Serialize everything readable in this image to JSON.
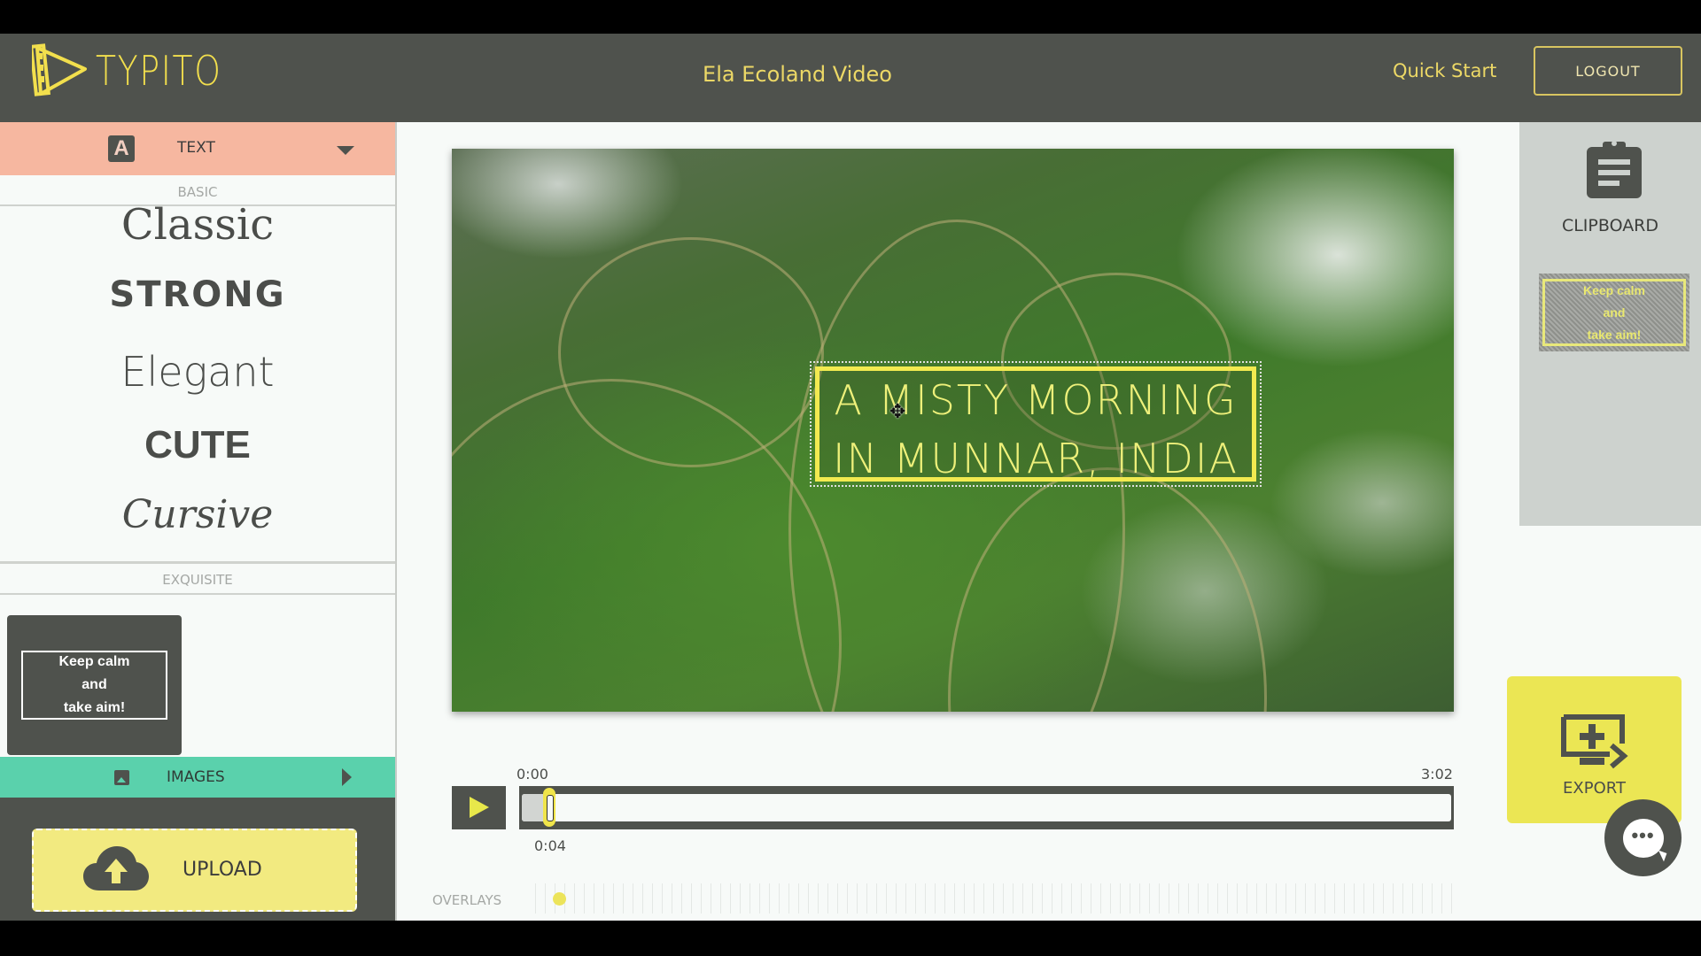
{
  "header": {
    "logo_text": "TYPITO",
    "project_title": "Ela Ecoland Video",
    "quick_start_label": "Quick Start",
    "logout_label": "LOGOUT"
  },
  "colors": {
    "header_bg": "#4f524d",
    "accent_yellow": "#f2df4d",
    "text_panel": "#f6b7a0",
    "images_panel": "#5ad1ac",
    "export_bg": "#ebe654",
    "clipboard_bg": "#cdd2ce"
  },
  "sidebar": {
    "text_section": {
      "icon": "letter-a-icon",
      "icon_glyph": "A",
      "label": "TEXT",
      "expanded": true
    },
    "basic_label": "BASIC",
    "basic_styles": [
      "Classic",
      "STRONG",
      "Elegant",
      "CUTE",
      "Cursive"
    ],
    "exquisite_label": "EXQUISITE",
    "exquisite_items": [
      {
        "lines": [
          "Keep calm",
          "and",
          "take aim!"
        ]
      }
    ],
    "images_section": {
      "icon": "image-icon",
      "label": "IMAGES",
      "expanded": false
    },
    "upload_label": "UPLOAD"
  },
  "stage": {
    "caption": {
      "line1": "A MISTY MORNING",
      "line2": "IN MUNNAR, INDIA"
    },
    "timeline": {
      "start_label": "0:00",
      "end_label": "3:02",
      "current_label": "0:04",
      "current_seconds": 4,
      "duration_seconds": 182
    },
    "overlays_label": "OVERLAYS",
    "overlay_markers_seconds": [
      4
    ]
  },
  "clipboard": {
    "label": "CLIPBOARD",
    "items": [
      {
        "lines": [
          "Keep calm",
          "and",
          "take aim!"
        ]
      }
    ]
  },
  "export": {
    "label": "EXPORT"
  },
  "chat": {
    "glyph": "•••"
  }
}
